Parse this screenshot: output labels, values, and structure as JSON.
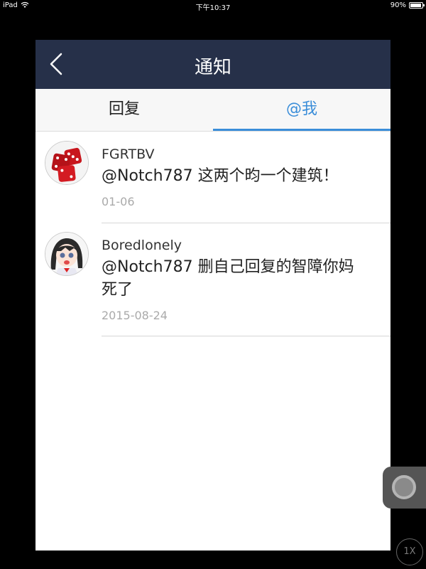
{
  "status_bar": {
    "device": "iPad",
    "time": "下午10:37",
    "battery": "90%"
  },
  "nav": {
    "title": "通知",
    "back_icon": "chevron-left-icon"
  },
  "tabs": [
    {
      "label": "回复",
      "active": false
    },
    {
      "label": "@我",
      "active": true
    }
  ],
  "notifications": [
    {
      "user": "FGRTBV",
      "message": "@Notch787 这两个昀一个建筑！",
      "date": "01-06",
      "avatar": "red-dice-avatar"
    },
    {
      "user": "Boredlonely",
      "message": "@Notch787 删自己回复的智障你妈死了",
      "date": "2015-08-24",
      "avatar": "anime-girl-avatar"
    }
  ],
  "zoom": {
    "label": "1X"
  },
  "colors": {
    "nav_bg": "#263049",
    "accent": "#3b8ed9"
  }
}
